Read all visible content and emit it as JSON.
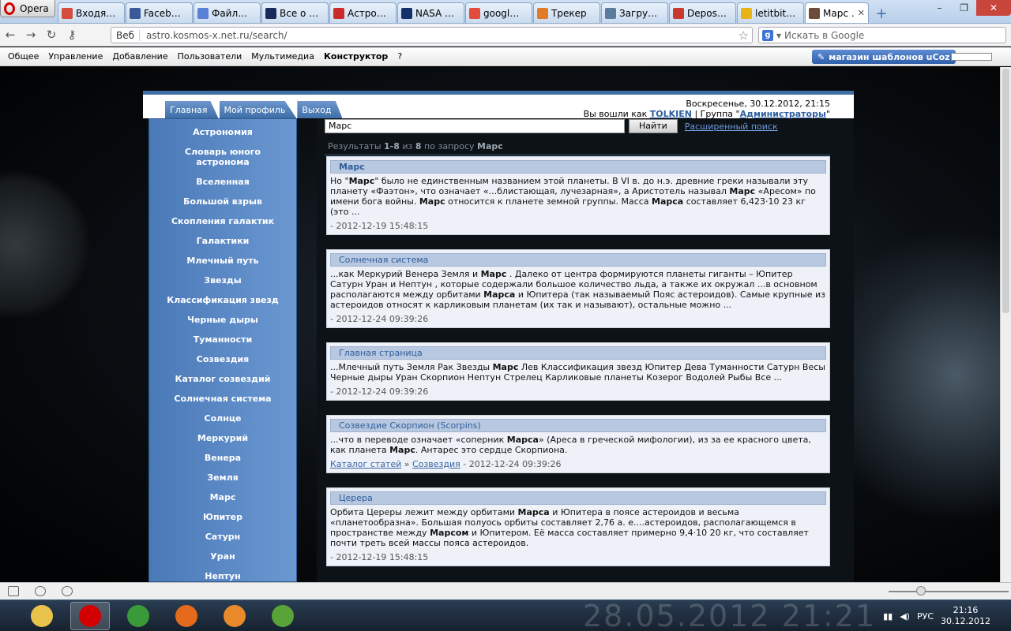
{
  "browser": {
    "app_button": "Opera",
    "tabs": [
      {
        "label": "Входя…",
        "color": "#d64b3f"
      },
      {
        "label": "Faceb…",
        "color": "#3b5998"
      },
      {
        "label": "Файл…",
        "color": "#5a7fd6"
      },
      {
        "label": "Все о …",
        "color": "#1a2a5c"
      },
      {
        "label": "Астро…",
        "color": "#cc2b2b"
      },
      {
        "label": "NASA …",
        "color": "#14306b"
      },
      {
        "label": "googl…",
        "color": "#e34b3b"
      },
      {
        "label": "Трекер",
        "color": "#e07b2a"
      },
      {
        "label": "Загру…",
        "color": "#5b7b9e"
      },
      {
        "label": "Depos…",
        "color": "#c83a2e"
      },
      {
        "label": "letitbit…",
        "color": "#e8b317"
      },
      {
        "label": "Марс …",
        "color": "#6b4c3a",
        "active": true
      }
    ],
    "new_tab": "+",
    "window_controls": {
      "minimize": "–",
      "maximize": "❐",
      "close": "✕"
    },
    "address": {
      "scheme_label": "Веб",
      "url": "astro.kosmos-x.net.ru/search/"
    },
    "search": {
      "engine_icon": "g",
      "placeholder": "Искать в Google"
    }
  },
  "ucoz_bar": {
    "items": [
      "Общее",
      "Управление",
      "Добавление",
      "Пользователи",
      "Мультимедиа",
      "Конструктор",
      "?"
    ],
    "shop_button": "магазин шаблонов uCoz"
  },
  "site": {
    "nav_tabs": [
      "Главная",
      "Мой профиль",
      "Выход"
    ],
    "date_line": "Воскресенье, 30.12.2012, 21:15",
    "logged_prefix": "Вы вошли как",
    "username": "TOLKIEN",
    "group_prefix": "| Группа \"",
    "group_name": "Администраторы",
    "group_suffix": "\"",
    "menu": [
      "Астрономия",
      "Словарь юного астронома",
      "Вселенная",
      "Большой взрыв",
      "Скопления галактик",
      "Галактики",
      "Млечный путь",
      "Звезды",
      "Классификация звезд",
      "Черные дыры",
      "Туманности",
      "Созвездия",
      "Каталог созвездий",
      "Солнечная система",
      "Солнце",
      "Меркурий",
      "Венера",
      "Земля",
      "Марс",
      "Юпитер",
      "Сатурн",
      "Уран",
      "Нептун"
    ],
    "search": {
      "query": "Марс",
      "button": "Найти",
      "advanced": "Расширенный поиск"
    },
    "results_summary": {
      "prefix": "Результаты",
      "range": "1-8",
      "of": "из",
      "total": "8",
      "by_query": "по запросу",
      "query": "Марс"
    },
    "results": [
      {
        "title": "Марс",
        "bold_title": true,
        "html": "Но \"<b>Марс</b>\" было не единственным названием этой планеты. В VI в. до н.э. древние греки называли эту планету «Фаэтон», что означает «...блистающая, лучезарная», а Аристотель называл <b>Марс</b> «Аресом» по имени бога войны. <b>Марс</b> относится к планете земной группы. Масса <b>Марса</b> составляет 6,423·10 23 кг (это ...",
        "date": "- 2012-12-19 15:48:15"
      },
      {
        "title": "Солнечная система",
        "html": "...как Меркурий Венера Земля и <b>Марс</b> . Далеко от центра формируются планеты гиганты – Юпитер Сатурн Уран и Нептун , которые содержали большое количество льда, а также их окружал ...в основном располагаются между орбитами <b>Марса</b> и Юпитера (так называемый Пояс астероидов). Самые крупные из астероидов относят к карликовым планетам (их так и называют), остальные можно ...",
        "date": "- 2012-12-24 09:39:26"
      },
      {
        "title": "Главная страница",
        "html": "...Млечный путь Земля Рак Звезды <b>Марс</b> Лев Классификация звезд Юпитер Дева Туманности Сатурн Весы Черные дыры Уран Скорпион Нептун Стрелец Карликовые планеты Козерог Водолей Рыбы Все ...",
        "date": "- 2012-12-24 09:39:26"
      },
      {
        "title": "Созвездие Скорпион (Scorpins)",
        "html": "...что в переводе означает «соперник <b>Марса</b>» (Ареса в греческой мифологии), из за ее красного цвета, как планета <b>Марс</b>. Антарес это сердце Скорпиона.",
        "crumbs": [
          "Каталог статей",
          "Созвездия"
        ],
        "date": "- 2012-12-24 09:39:26"
      },
      {
        "title": "Церера",
        "html": "Орбита Цереры лежит между орбитами <b>Марса</b> и Юпитера в поясе астероидов и весьма «планетообразна». Большая полуось орбиты составляет 2,76 а. е....астероидов, располагающемся в пространстве между <b>Марсом</b> и Юпитером. Её масса составляет примерно 9,4·10 20 кг, что составляет почти треть всей массы пояса астероидов.",
        "date": "- 2012-12-19 15:48:15"
      }
    ]
  },
  "taskbar": {
    "apps": [
      {
        "name": "explorer",
        "color": "#e8c24a"
      },
      {
        "name": "opera",
        "color": "#d20000",
        "active": true
      },
      {
        "name": "chrome",
        "color": "#3a9a3a"
      },
      {
        "name": "firefox",
        "color": "#e56a1c"
      },
      {
        "name": "media-player",
        "color": "#e98a2a"
      },
      {
        "name": "utorrent",
        "color": "#5aa338"
      }
    ],
    "watermark": "28.05.2012 21:21",
    "language": "РУС",
    "time": "21:16",
    "date": "30.12.2012"
  }
}
